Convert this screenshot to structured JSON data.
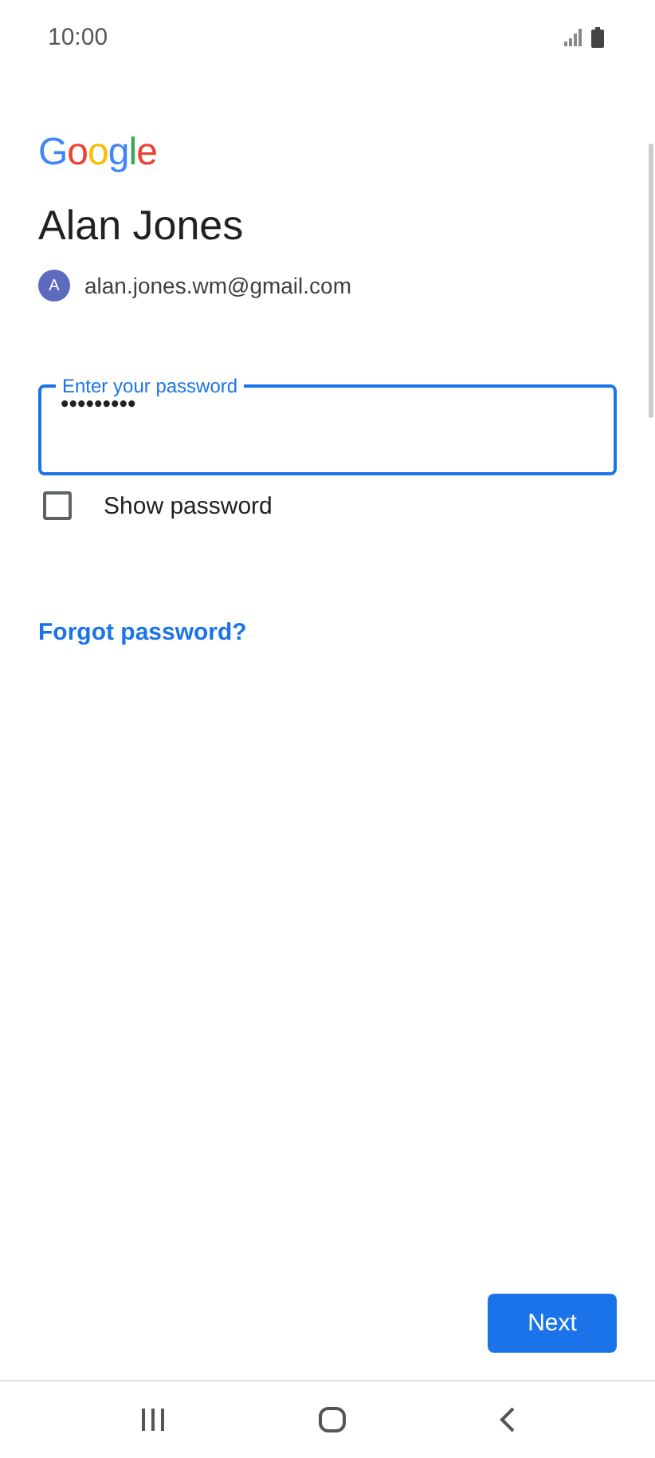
{
  "status_bar": {
    "time": "10:00"
  },
  "logo": "Google",
  "account": {
    "name": "Alan Jones",
    "avatar_letter": "A",
    "email": "alan.jones.wm@gmail.com"
  },
  "password_field": {
    "label": "Enter your password",
    "value": "•••••••••"
  },
  "show_password": {
    "label": "Show password",
    "checked": false
  },
  "forgot_link": "Forgot password?",
  "next_button": "Next"
}
